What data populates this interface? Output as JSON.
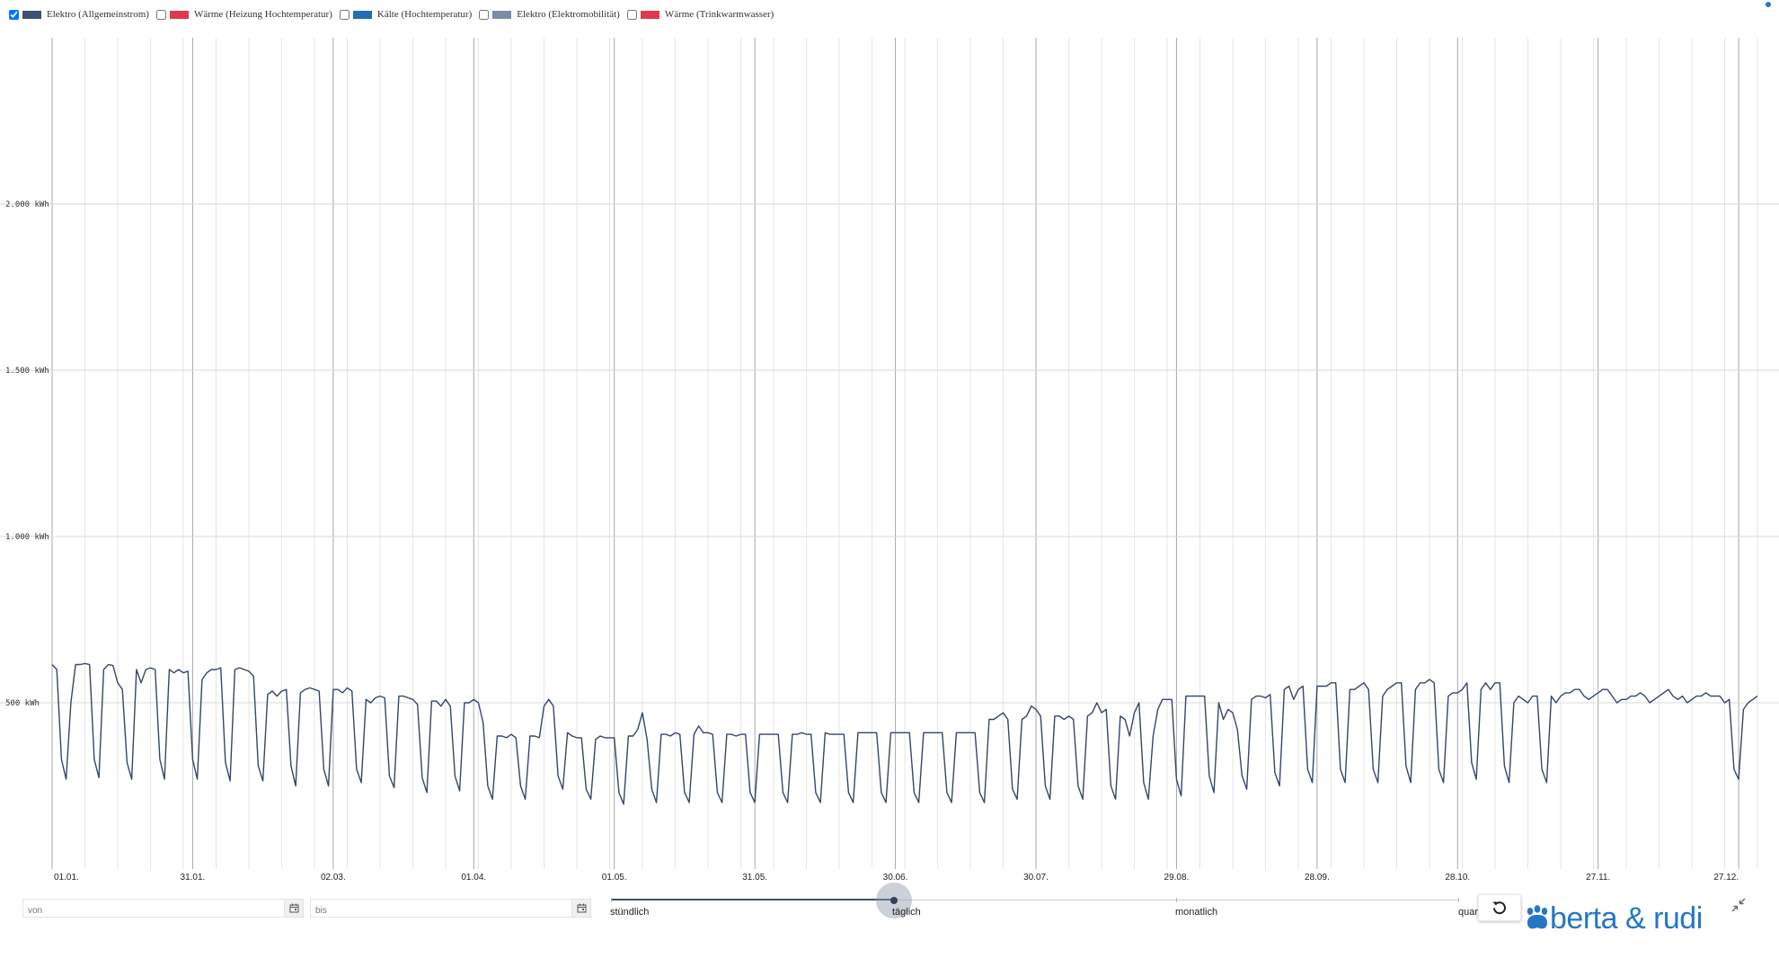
{
  "legend": [
    {
      "label": "Elektro (Allgemeinstrom)",
      "color": "#3e5170",
      "checked": true
    },
    {
      "label": "Wärme (Heizung Hochtemperatur)",
      "color": "#e0394f",
      "checked": false
    },
    {
      "label": "Kälte (Hochtemperatur)",
      "color": "#1f6fb7",
      "checked": false
    },
    {
      "label": "Elektro (Elektromobilität)",
      "color": "#7b8ca8",
      "checked": false
    },
    {
      "label": "Wärme (Trinkwarmwasser)",
      "color": "#e0394f",
      "checked": false
    }
  ],
  "controls": {
    "from_placeholder": "von",
    "to_placeholder": "bis",
    "resolution_labels": [
      "stündlich",
      "täglich",
      "monatlich",
      "quar"
    ],
    "selected_resolution": "täglich"
  },
  "brand": {
    "name": "berta & rudi",
    "color": "#2577c4"
  },
  "chart_data": {
    "type": "line",
    "x_start": "01.01.",
    "x_tick_labels": [
      "01.01.",
      "31.01.",
      "02.03.",
      "01.04.",
      "01.05.",
      "31.05.",
      "30.06.",
      "30.07.",
      "29.08.",
      "28.09.",
      "28.10.",
      "27.11.",
      "27.12."
    ],
    "y_tick_labels": [
      "500 kWh",
      "1.000 kWh",
      "1.500 kWh",
      "2.000 kWh"
    ],
    "ylim": [
      0,
      2500
    ],
    "grid": true,
    "series": [
      {
        "name": "Elektro (Allgemeinstrom)",
        "color": "#3e5170",
        "weekly_pattern": [
          [
            615,
            600,
            330,
            270,
            500,
            615,
            615
          ],
          [
            618,
            615,
            330,
            275,
            600,
            615,
            612
          ],
          [
            560,
            540,
            320,
            270,
            600,
            560,
            600
          ],
          [
            605,
            600,
            330,
            270,
            600,
            590,
            600
          ],
          [
            590,
            595,
            330,
            270,
            570,
            590,
            600
          ],
          [
            600,
            605,
            320,
            265,
            600,
            605,
            600
          ],
          [
            595,
            580,
            310,
            265,
            525,
            535,
            520
          ],
          [
            535,
            540,
            310,
            250,
            530,
            540,
            545
          ],
          [
            540,
            535,
            300,
            250,
            540,
            540,
            530
          ],
          [
            545,
            535,
            300,
            260,
            510,
            500,
            515
          ],
          [
            520,
            515,
            280,
            245,
            520,
            520,
            515
          ],
          [
            510,
            495,
            275,
            230,
            505,
            505,
            490
          ],
          [
            510,
            490,
            280,
            235,
            500,
            500,
            510
          ],
          [
            500,
            440,
            250,
            210,
            400,
            400,
            395
          ],
          [
            405,
            395,
            250,
            210,
            400,
            400,
            395
          ],
          [
            490,
            510,
            490,
            280,
            240,
            410,
            400
          ],
          [
            395,
            395,
            240,
            210,
            390,
            400,
            395
          ],
          [
            395,
            395,
            230,
            195,
            400,
            400,
            420
          ],
          [
            470,
            390,
            240,
            200,
            405,
            405,
            400
          ],
          [
            410,
            405,
            230,
            200,
            405,
            430,
            410
          ],
          [
            410,
            405,
            230,
            200,
            405,
            405,
            400
          ],
          [
            405,
            405,
            230,
            200,
            405,
            405,
            405
          ],
          [
            405,
            405,
            230,
            200,
            405,
            405,
            410
          ],
          [
            405,
            405,
            230,
            200,
            410,
            405,
            405
          ],
          [
            405,
            405,
            230,
            200,
            410,
            410,
            410
          ],
          [
            410,
            410,
            230,
            200,
            410,
            410,
            410
          ],
          [
            410,
            410,
            230,
            200,
            410,
            410,
            410
          ],
          [
            410,
            410,
            230,
            200,
            410,
            410,
            410
          ],
          [
            410,
            410,
            230,
            200,
            450,
            450,
            460
          ],
          [
            470,
            450,
            240,
            210,
            450,
            460,
            490
          ],
          [
            480,
            460,
            250,
            210,
            460,
            460,
            450
          ],
          [
            460,
            450,
            250,
            210,
            460,
            470,
            500
          ],
          [
            470,
            480,
            250,
            210,
            460,
            450,
            400
          ],
          [
            470,
            500,
            260,
            210,
            400,
            480,
            510
          ],
          [
            510,
            510,
            270,
            220,
            520,
            520,
            520
          ],
          [
            520,
            520,
            280,
            230,
            500,
            450,
            480
          ],
          [
            470,
            420,
            280,
            240,
            510,
            520,
            520
          ],
          [
            515,
            525,
            290,
            250,
            540,
            550,
            510
          ],
          [
            540,
            550,
            300,
            260,
            550,
            550,
            550
          ],
          [
            560,
            560,
            300,
            260,
            540,
            540,
            550
          ],
          [
            560,
            540,
            300,
            260,
            520,
            540,
            550
          ],
          [
            560,
            560,
            310,
            260,
            540,
            560,
            560
          ],
          [
            570,
            560,
            300,
            260,
            520,
            530,
            530
          ],
          [
            540,
            560,
            320,
            270,
            540,
            560,
            540
          ],
          [
            560,
            560,
            310,
            260,
            500,
            520,
            510
          ],
          [
            500,
            520,
            520,
            300,
            260,
            520,
            500
          ],
          [
            520,
            530,
            530,
            540,
            540,
            520,
            510
          ],
          [
            520,
            530,
            540,
            540,
            520,
            500,
            510
          ],
          [
            510,
            520,
            520,
            530,
            520,
            500,
            510
          ],
          [
            520,
            530,
            540,
            520,
            510,
            520,
            500
          ],
          [
            510,
            520,
            520,
            530,
            520,
            520,
            520
          ],
          [
            500,
            510,
            300,
            270,
            480,
            500,
            510
          ],
          [
            520
          ]
        ]
      }
    ]
  }
}
